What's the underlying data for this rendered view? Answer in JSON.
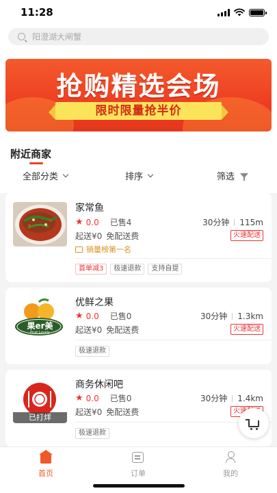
{
  "status": {
    "time": "11:28"
  },
  "search": {
    "placeholder": "阳澄湖大闸蟹"
  },
  "banner": {
    "title": "抢购精选会场",
    "subtitle": "限时限量抢半价"
  },
  "section": {
    "title": "附近商家"
  },
  "filters": {
    "category": "全部分类",
    "sort": "排序",
    "filter": "筛选"
  },
  "shops": [
    {
      "name": "家常鱼",
      "rating": "0.0",
      "sold": "已售4",
      "time": "30分钟",
      "distance": "115m",
      "min_order": "起送¥0",
      "delivery_fee": "免配送费",
      "fast_badge": "火速配送",
      "rank": "销量榜第一名",
      "tags": [
        "首单减3",
        "极速退款",
        "支持自提"
      ]
    },
    {
      "name": "优鲜之果",
      "rating": "0.0",
      "sold": "已售0",
      "time": "30分钟",
      "distance": "1.3km",
      "min_order": "起送¥0",
      "delivery_fee": "免配送费",
      "fast_badge": "火速配送",
      "logo_text": "果er美",
      "logo_sub": "Fruit Lovely",
      "tags": [
        "极速退款"
      ]
    },
    {
      "name": "商务休闲吧",
      "rating": "0.0",
      "sold": "已售0",
      "time": "30分钟",
      "distance": "1.4km",
      "min_order": "起送¥0",
      "delivery_fee": "免配送费",
      "fast_badge": "火速配送",
      "closed_label": "已打烊",
      "tags": [
        "极速退款"
      ]
    }
  ],
  "tabbar": {
    "home": "首页",
    "orders": "订单",
    "mine": "我的"
  },
  "colors": {
    "accent": "#ee5a2a",
    "price_red": "#e33333",
    "banner_red": "#ee3f22",
    "ribbon_yellow": "#fbe45a"
  }
}
